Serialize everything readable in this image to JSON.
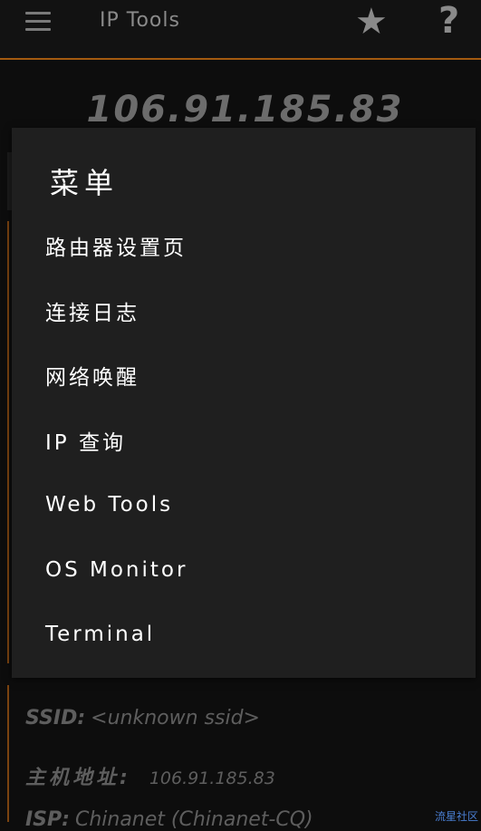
{
  "app_bar": {
    "title": "IP Tools",
    "menu_icon": "hamburger-menu-icon",
    "star_icon": "star-icon",
    "help_icon": "help-icon"
  },
  "main": {
    "ip_address": "106.91.185.83"
  },
  "info": {
    "ssid_label": "SSID:",
    "ssid_value": "<unknown ssid>",
    "host_label": "主机地址:",
    "host_value": "106.91.185.83",
    "isp_label": "ISP:",
    "isp_value": "Chinanet (Chinanet-CQ)"
  },
  "menu": {
    "header": "菜单",
    "items": [
      {
        "label": "路由器设置页"
      },
      {
        "label": "连接日志"
      },
      {
        "label": "网络唤醒"
      },
      {
        "label": "IP 查询"
      },
      {
        "label": "Web Tools"
      },
      {
        "label": "OS Monitor"
      },
      {
        "label": "Terminal"
      }
    ]
  },
  "watermark": "流星社区"
}
